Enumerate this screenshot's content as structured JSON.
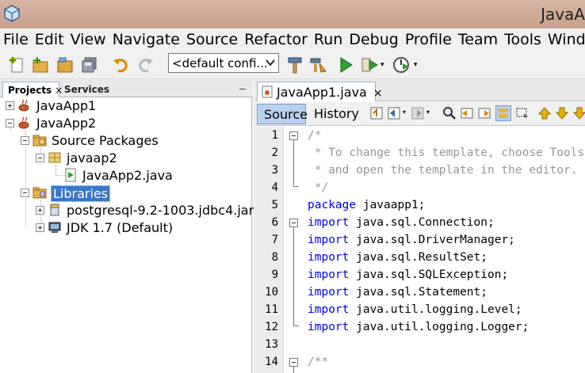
{
  "window": {
    "title": "JavaA"
  },
  "menu": [
    "File",
    "Edit",
    "View",
    "Navigate",
    "Source",
    "Refactor",
    "Run",
    "Debug",
    "Profile",
    "Team",
    "Tools",
    "Window"
  ],
  "toolbar": {
    "config_value": "<default confi..."
  },
  "projects_panel": {
    "tabs": [
      {
        "label": "Projects",
        "close": "×"
      },
      {
        "label": "Services"
      }
    ],
    "minimize": "–",
    "tree": [
      {
        "label": "JavaApp1",
        "icon": "java-project-icon"
      },
      {
        "label": "JavaApp2",
        "icon": "java-project-icon"
      },
      {
        "label": "Source Packages",
        "icon": "source-folder-icon"
      },
      {
        "label": "javaap2",
        "icon": "package-icon"
      },
      {
        "label": "JavaApp2.java",
        "icon": "java-file-icon"
      },
      {
        "label": "Libraries",
        "icon": "libraries-folder-icon",
        "selected": true
      },
      {
        "label": "postgresql-9.2-1003.jdbc4.jar",
        "icon": "jar-icon"
      },
      {
        "label": "JDK 1.7 (Default)",
        "icon": "jdk-icon"
      }
    ]
  },
  "editor": {
    "tab": {
      "label": "JavaApp1.java",
      "close": "×"
    },
    "source_label": "Source",
    "history_label": "History",
    "line_numbers": [
      "1",
      "2",
      "3",
      "4",
      "5",
      "6",
      "7",
      "8",
      "9",
      "10",
      "11",
      "12",
      "13",
      "14"
    ],
    "code": [
      {
        "parts": [
          [
            "cm",
            "/*"
          ]
        ]
      },
      {
        "parts": [
          [
            "cm",
            " * To change this template, choose Tools | Templates"
          ]
        ]
      },
      {
        "parts": [
          [
            "cm",
            " * and open the template in the editor."
          ]
        ]
      },
      {
        "parts": [
          [
            "cm",
            " */"
          ]
        ]
      },
      {
        "parts": [
          [
            "kw",
            "package"
          ],
          [
            "norm",
            " javaapp1;"
          ]
        ]
      },
      {
        "parts": [
          [
            "kw",
            "import"
          ],
          [
            "norm",
            " java.sql.Connection;"
          ]
        ]
      },
      {
        "parts": [
          [
            "kw",
            "import"
          ],
          [
            "norm",
            " java.sql.DriverManager;"
          ]
        ]
      },
      {
        "parts": [
          [
            "kw",
            "import"
          ],
          [
            "norm",
            " java.sql.ResultSet;"
          ]
        ]
      },
      {
        "parts": [
          [
            "kw",
            "import"
          ],
          [
            "norm",
            " java.sql.SQLException;"
          ]
        ]
      },
      {
        "parts": [
          [
            "kw",
            "import"
          ],
          [
            "norm",
            " java.sql.Statement;"
          ]
        ]
      },
      {
        "parts": [
          [
            "kw",
            "import"
          ],
          [
            "norm",
            " java.util.logging.Level;"
          ]
        ]
      },
      {
        "parts": [
          [
            "kw",
            "import"
          ],
          [
            "norm",
            " java.util.logging.Logger;"
          ]
        ]
      },
      {
        "parts": []
      },
      {
        "parts": [
          [
            "cm",
            "/**"
          ]
        ]
      }
    ]
  },
  "colors": {
    "keyword": "#0000e6",
    "comment": "#969696",
    "selection": "#3a77c6",
    "source_tab": "#b9d0ef"
  }
}
